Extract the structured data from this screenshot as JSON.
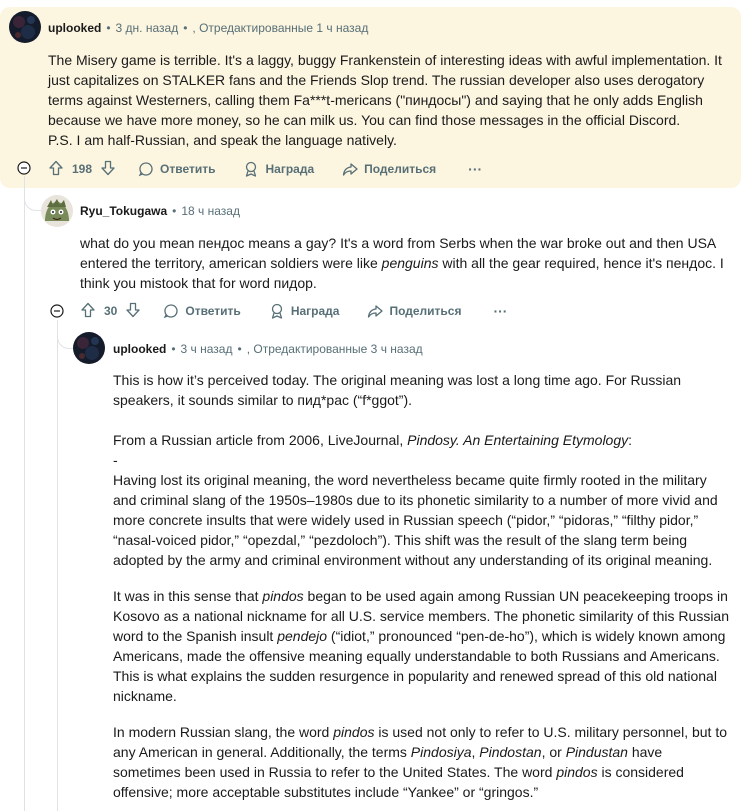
{
  "comment1": {
    "author": "uplooked",
    "time": "3 дн. назад",
    "edited": "Отредактированные 1 ч назад",
    "paragraphs": [
      "The Misery game is terrible. It's a laggy, buggy Frankenstein of interesting ideas with awful implementation. It just capitalizes on STALKER fans and the Friends Slop trend. The russian developer also uses derogatory terms against Westerners, calling them Fa***t-mericans (\"пиндосы\") and saying that he only adds English because we have more money, so he can milk us. You can find those messages in the official Discord.",
      "P.S. I am half-Russian, and speak the language natively."
    ],
    "score": "198",
    "reply_label": "Ответить",
    "award_label": "Награда",
    "share_label": "Поделиться",
    "more_label": "···"
  },
  "comment2": {
    "author": "Ryu_Tokugawa",
    "time": "18 ч назад",
    "text_a": "what do you mean пендос means a gay? It's a word from Serbs when the war broke out and then USA entered the territory, american soldiers were like ",
    "text_em": "penguins",
    "text_b": " with all the gear required, hence it's пендос. I think you mistook that for word пидор.",
    "score": "30",
    "reply_label": "Ответить",
    "award_label": "Награда",
    "share_label": "Поделиться",
    "more_label": "···"
  },
  "comment3": {
    "author": "uplooked",
    "time": "3 ч назад",
    "edited": "Отредактированные 3 ч назад",
    "p1": "This is how it’s perceived today. The original meaning was lost a long time ago. For Russian speakers, it sounds similar to пид*рас (“f*ggot”).",
    "p2_a": "From a Russian article from 2006, LiveJournal, ",
    "p2_em": "Pindosy. An Entertaining Etymology",
    "p2_b": ":",
    "p2_dash": "-",
    "p2_c": "Having lost its original meaning, the word nevertheless became quite firmly rooted in the military and criminal slang of the 1950s–1980s due to its phonetic similarity to a number of more vivid and more concrete insults that were widely used in Russian speech (“pidor,” “pidoras,” “filthy pidor,” “nasal-voiced pidor,” “opezdal,” “pezdoloch”). This shift was the result of the slang term being adopted by the army and criminal environment without any understanding of its original meaning.",
    "p3_a": "It was in this sense that ",
    "p3_em1": "pindos",
    "p3_b": " began to be used again among Russian UN peacekeeping troops in Kosovo as a national nickname for all U.S. service members. The phonetic similarity of this Russian word to the Spanish insult ",
    "p3_em2": "pendejo",
    "p3_c": " (“idiot,” pronounced “pen-de-ho”), which is widely known among Americans, made the offensive meaning equally understandable to both Russians and Americans. This is what explains the sudden resurgence in popularity and renewed spread of this old national nickname.",
    "p4_a": "In modern Russian slang, the word ",
    "p4_em1": "pindos",
    "p4_b": " is used not only to refer to U.S. military personnel, but to any American in general. Additionally, the terms ",
    "p4_em2": "Pindosiya",
    "p4_c": ", ",
    "p4_em3": "Pindostan",
    "p4_d": ", or ",
    "p4_em4": "Pindustan",
    "p4_e": " have sometimes been used in Russia to refer to the United States. The word ",
    "p4_em5": "pindos",
    "p4_f": " is considered offensive; more acceptable substitutes include “Yankee” or “gringos.”"
  },
  "colors": {
    "highlight_bg": "#fcf5e0",
    "meta_text": "#576f76",
    "body_text": "#1a1a1b"
  },
  "icons": [
    "collapse-icon",
    "upvote-icon",
    "downvote-icon",
    "comment-icon",
    "award-icon",
    "share-icon",
    "more-icon"
  ]
}
